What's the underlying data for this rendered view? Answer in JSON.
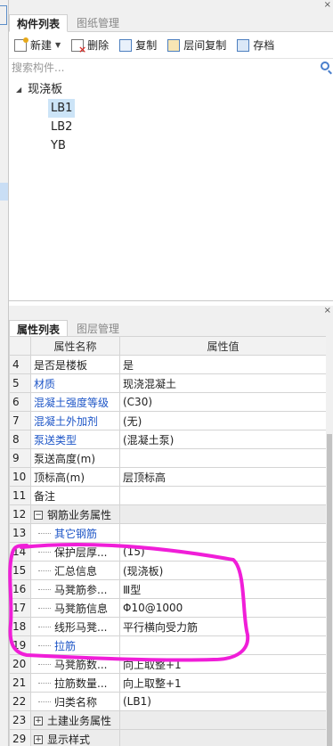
{
  "top_panel": {
    "tabs": [
      "构件列表",
      "图纸管理"
    ],
    "close": "×",
    "toolbar": {
      "new": "新建",
      "delete": "删除",
      "copy": "复制",
      "floor_copy": "层间复制",
      "save": "存档"
    },
    "search_placeholder": "搜索构件...",
    "tree": {
      "root": "现浇板",
      "children": [
        "LB1",
        "LB2",
        "YB"
      ]
    }
  },
  "bottom_panel": {
    "tabs": [
      "属性列表",
      "图层管理"
    ],
    "close": "×",
    "headers": [
      "属性名称",
      "属性值"
    ],
    "rows": [
      {
        "n": "4",
        "name": "是否是楼板",
        "value": "是"
      },
      {
        "n": "5",
        "name": "材质",
        "value": "现浇混凝土"
      },
      {
        "n": "6",
        "name": "混凝土强度等级",
        "value": "(C30)"
      },
      {
        "n": "7",
        "name": "混凝土外加剂",
        "value": "(无)"
      },
      {
        "n": "8",
        "name": "泵送类型",
        "value": "(混凝土泵)"
      },
      {
        "n": "9",
        "name": "泵送高度(m)",
        "value": ""
      },
      {
        "n": "10",
        "name": "顶标高(m)",
        "value": "层顶标高"
      },
      {
        "n": "11",
        "name": "备注",
        "value": ""
      },
      {
        "n": "12",
        "name": "钢筋业务属性",
        "value": ""
      },
      {
        "n": "13",
        "name": "其它钢筋",
        "value": ""
      },
      {
        "n": "14",
        "name": "保护层厚...",
        "value": "(15)"
      },
      {
        "n": "15",
        "name": "汇总信息",
        "value": "(现浇板)"
      },
      {
        "n": "16",
        "name": "马凳筋参...",
        "value": "Ⅲ型"
      },
      {
        "n": "17",
        "name": "马凳筋信息",
        "value": "Φ10@1000"
      },
      {
        "n": "18",
        "name": "线形马凳...",
        "value": "平行横向受力筋"
      },
      {
        "n": "19",
        "name": "拉筋",
        "value": ""
      },
      {
        "n": "20",
        "name": "马凳筋数...",
        "value": "向上取整+1"
      },
      {
        "n": "21",
        "name": "拉筋数量...",
        "value": "向上取整+1"
      },
      {
        "n": "22",
        "name": "归类名称",
        "value": "(LB1)"
      },
      {
        "n": "23",
        "name": "土建业务属性",
        "value": ""
      },
      {
        "n": "29",
        "name": "显示样式",
        "value": ""
      }
    ]
  },
  "colors": {
    "annotation": "#f01ed8",
    "link_text": "#1e56c7",
    "selected": "#cce4f7"
  }
}
